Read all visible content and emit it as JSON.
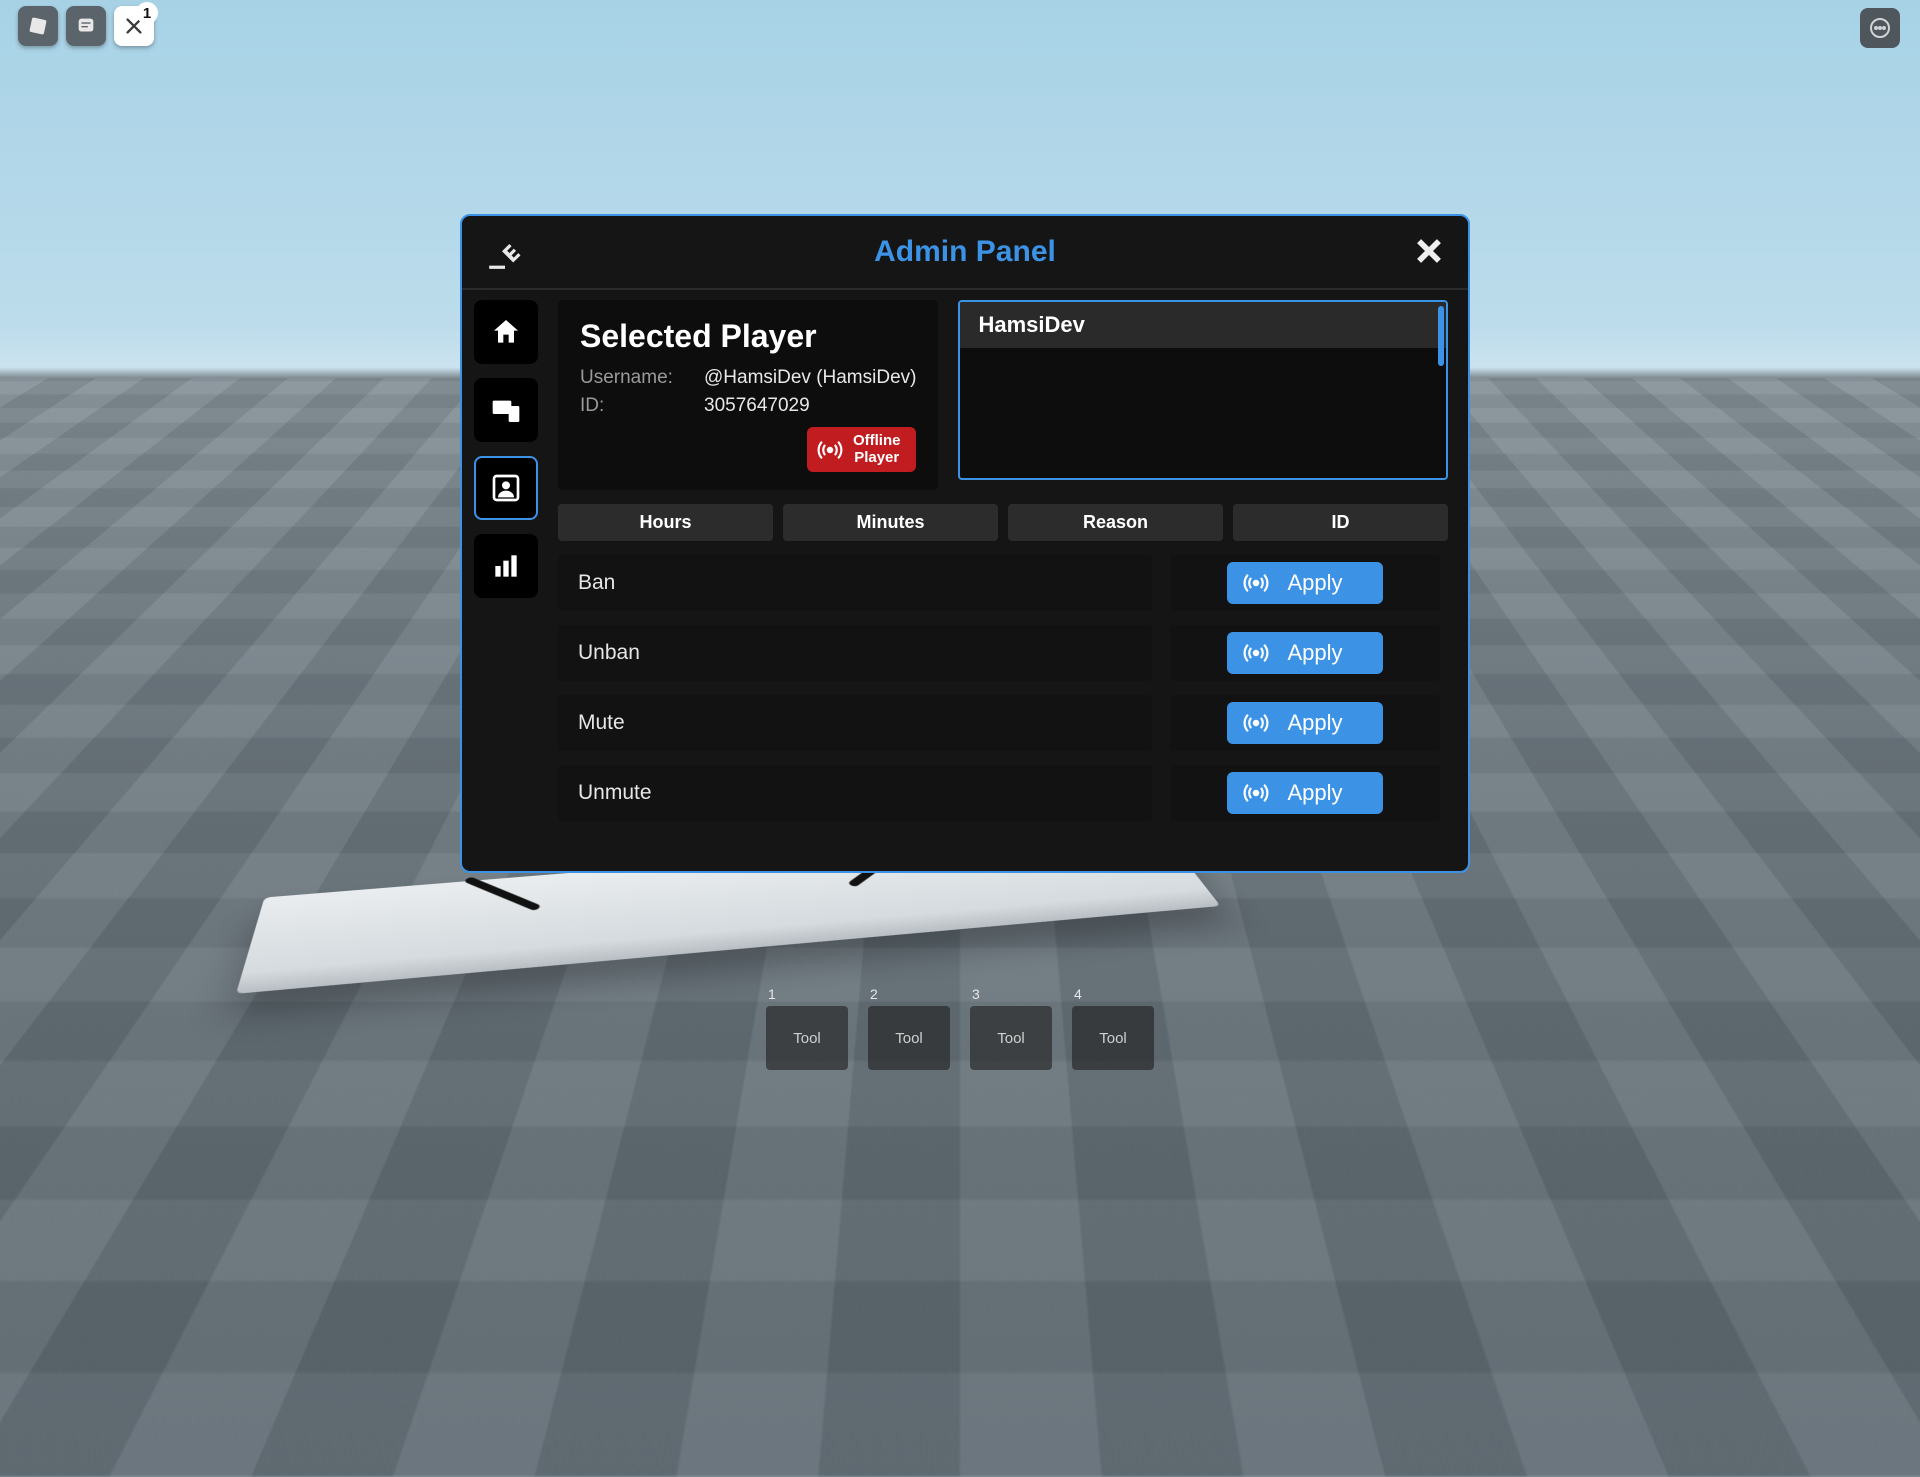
{
  "topbar": {
    "badge": "1"
  },
  "panel_title": "Admin Panel",
  "selected_player_heading": "Selected Player",
  "username_label": "Username:",
  "username_value": "@HamsiDev (HamsiDev)",
  "id_label": "ID:",
  "id_value": "3057647029",
  "offline_player_line1": "Offline",
  "offline_player_line2": "Player",
  "player_list": {
    "items": [
      "HamsiDev"
    ]
  },
  "fields": [
    "Hours",
    "Minutes",
    "Reason",
    "ID"
  ],
  "actions": [
    "Ban",
    "Unban",
    "Mute",
    "Unmute"
  ],
  "apply_label": "Apply",
  "hotbar": [
    {
      "num": "1",
      "label": "Tool"
    },
    {
      "num": "2",
      "label": "Tool"
    },
    {
      "num": "3",
      "label": "Tool"
    },
    {
      "num": "4",
      "label": "Tool"
    }
  ]
}
